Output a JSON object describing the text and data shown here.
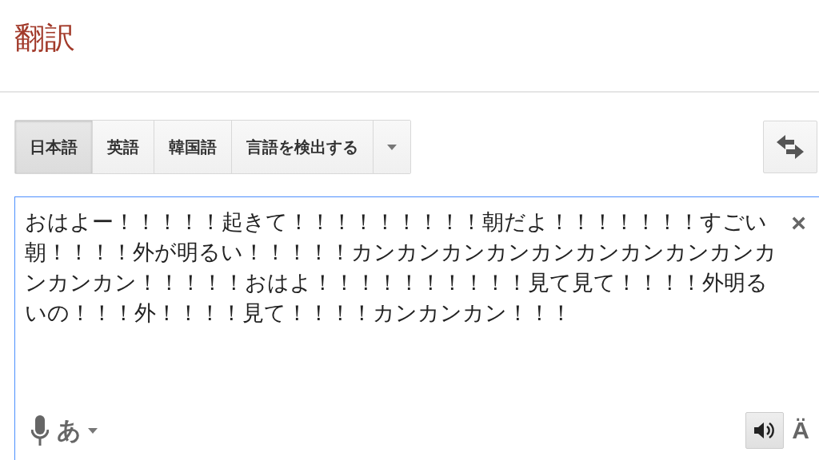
{
  "header": {
    "title": "翻訳"
  },
  "language_tabs": [
    {
      "label": "日本語",
      "selected": true
    },
    {
      "label": "英語",
      "selected": false
    },
    {
      "label": "韓国語",
      "selected": false
    },
    {
      "label": "言語を検出する",
      "selected": false
    }
  ],
  "source": {
    "value": "おはよー！！！！！起きて！！！！！！！！！朝だよ！！！！！！！すごい朝！！！！外が明るい！！！！！カンカンカンカンカンカンカンカンカンカンカンカン！！！！！おはよ！！！！！！！！！！見て見て！！！！外明るいの！！！外！！！！見て！！！！カンカンカン！！！",
    "clear": "×",
    "input_tool": "あ",
    "font_toggle": "Ä"
  }
}
